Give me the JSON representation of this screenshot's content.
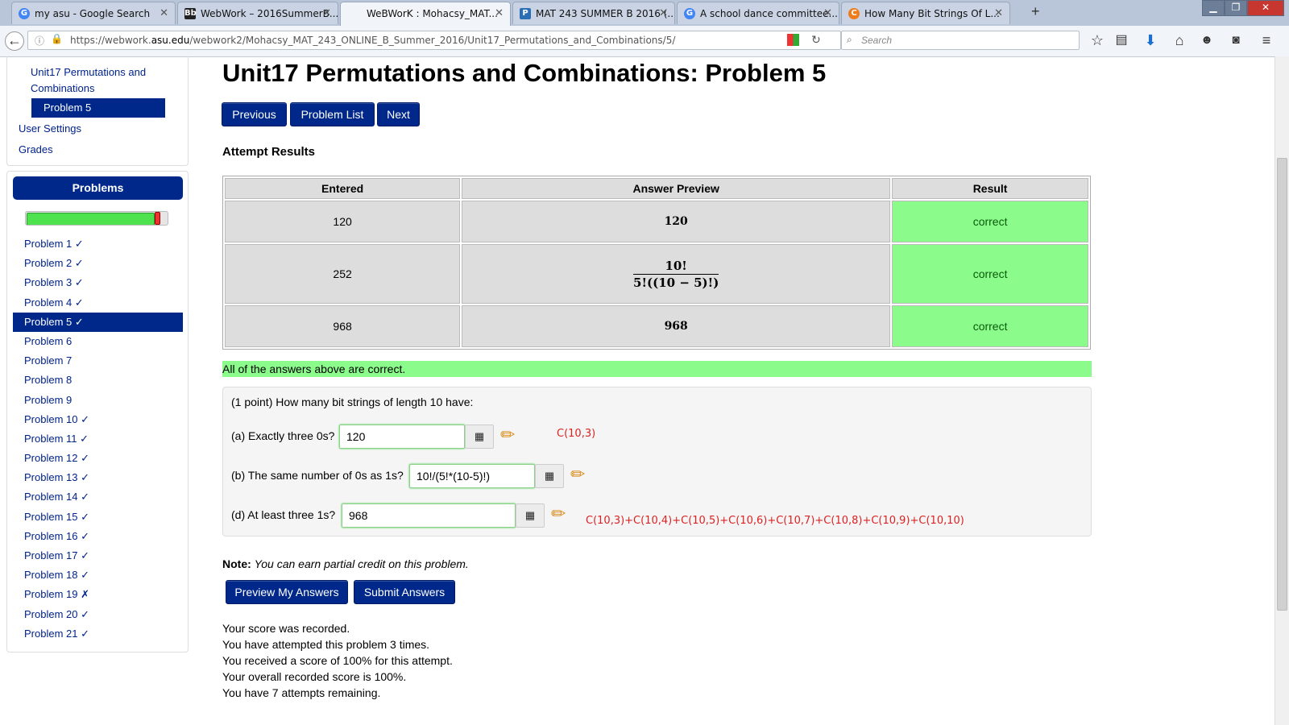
{
  "tabs": [
    {
      "title": "my asu - Google Search",
      "icon": "google-icon"
    },
    {
      "title": "WebWork – 2016SummerB...",
      "icon": "blackboard-icon"
    },
    {
      "title": "WeBWorK : Mohacsy_MAT...",
      "icon": "none",
      "active": true
    },
    {
      "title": "MAT 243 SUMMER B 2016 (...",
      "icon": "pearson-icon"
    },
    {
      "title": "A school dance committee...",
      "icon": "google-icon"
    },
    {
      "title": "How Many Bit Strings Of L...",
      "icon": "chegg-icon"
    }
  ],
  "browser": {
    "url_prefix": "https://webwork.",
    "url_domain": "asu.edu",
    "url_path": "/webwork2/Mohacsy_MAT_243_ONLINE_B_Summer_2016/Unit17_Permutations_and_Combinations/5/",
    "search_placeholder": "Search"
  },
  "sidebar": {
    "set_link": "Unit17 Permutations and Combinations",
    "current_problem": "Problem 5",
    "user_settings": "User Settings",
    "grades": "Grades",
    "problems_header": "Problems",
    "progress_fraction": 0.95,
    "problems": [
      "Problem 1 ✓",
      "Problem 2 ✓",
      "Problem 3 ✓",
      "Problem 4 ✓",
      "Problem 5 ✓",
      "Problem 6",
      "Problem 7",
      "Problem 8",
      "Problem 9",
      "Problem 10 ✓",
      "Problem 11 ✓",
      "Problem 12 ✓",
      "Problem 13 ✓",
      "Problem 14 ✓",
      "Problem 15 ✓",
      "Problem 16 ✓",
      "Problem 17 ✓",
      "Problem 18 ✓",
      "Problem 19 ✗",
      "Problem 20 ✓",
      "Problem 21 ✓"
    ],
    "current_index": 4
  },
  "main": {
    "title": "Unit17 Permutations and Combinations: Problem 5",
    "nav": {
      "previous": "Previous",
      "problem_list": "Problem List",
      "next": "Next"
    },
    "attempt_heading": "Attempt Results",
    "table": {
      "headers": [
        "Entered",
        "Answer Preview",
        "Result"
      ],
      "rows": [
        {
          "entered": "120",
          "preview": "120",
          "result": "correct"
        },
        {
          "entered": "252",
          "preview_num": "10!",
          "preview_den": "5!((10 − 5)!)",
          "result": "correct"
        },
        {
          "entered": "968",
          "preview": "968",
          "result": "correct"
        }
      ]
    },
    "all_correct": "All of the answers above are correct.",
    "problem": {
      "intro": "(1 point) How many bit strings of length 10 have:",
      "a_label": "(a) Exactly three 0s?",
      "a_value": "120",
      "a_note": "C(10,3)",
      "b_label": "(b) The same number of 0s as 1s?",
      "b_value": "10!/(5!*(10-5)!)",
      "d_label": "(d) At least three 1s?",
      "d_value": "968",
      "d_note": "C(10,3)+C(10,4)+C(10,5)+C(10,6)+C(10,7)+C(10,8)+C(10,9)+C(10,10)"
    },
    "note_label": "Note:",
    "note_text": "You can earn partial credit on this problem.",
    "buttons": {
      "preview": "Preview My Answers",
      "submit": "Submit Answers"
    },
    "score_lines": [
      "Your score was recorded.",
      "You have attempted this problem 3 times.",
      "You received a score of 100% for this attempt.",
      "Your overall recorded score is 100%.",
      "You have 7 attempts remaining."
    ]
  },
  "colors": {
    "primary": "#00288a",
    "correct_bg": "#8bfc8b",
    "note_red": "#dd2222"
  }
}
